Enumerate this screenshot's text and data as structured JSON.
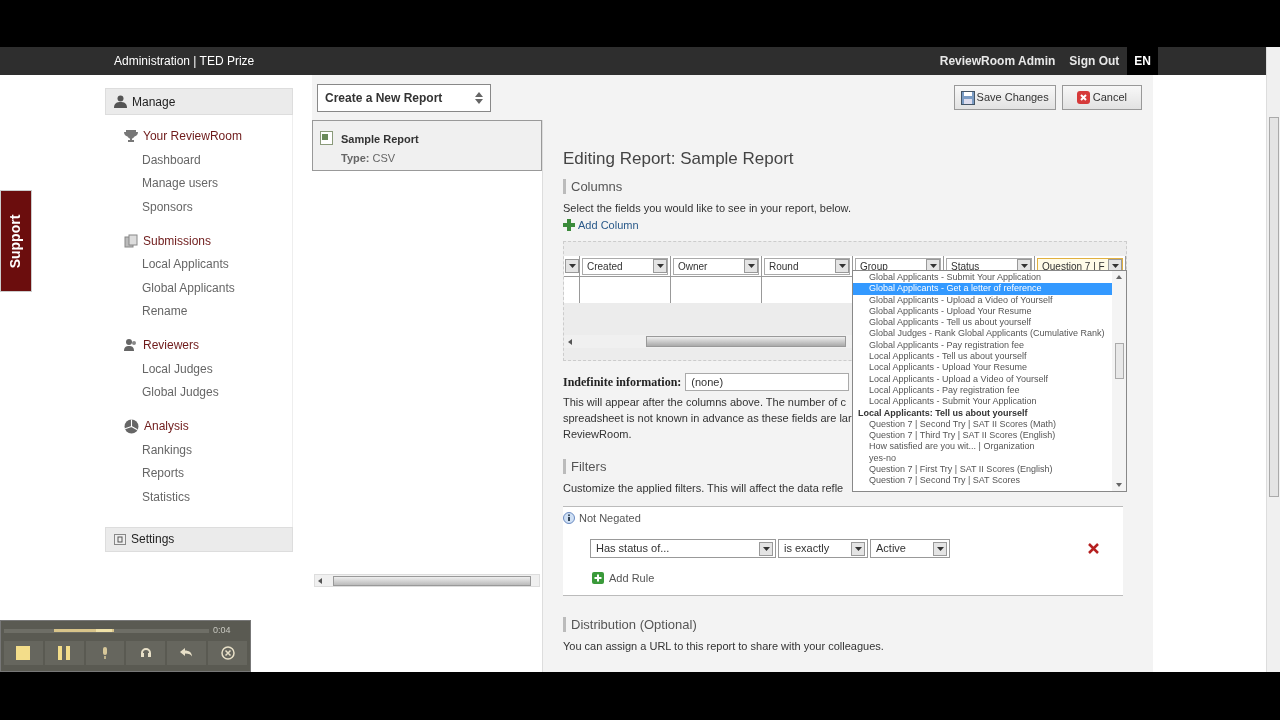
{
  "header": {
    "title": "Administration | TED Prize",
    "user": "ReviewRoom Admin",
    "sign_out": "Sign Out",
    "language": "EN"
  },
  "support_tab": "Support",
  "sidebar": {
    "manage": "Manage",
    "groups": [
      {
        "label": "Your ReviewRoom",
        "items": [
          "Dashboard",
          "Manage users",
          "Sponsors"
        ]
      },
      {
        "label": "Submissions",
        "items": [
          "Local Applicants",
          "Global Applicants",
          "Rename"
        ]
      },
      {
        "label": "Reviewers",
        "items": [
          "Local Judges",
          "Global Judges"
        ]
      },
      {
        "label": "Analysis",
        "items": [
          "Rankings",
          "Reports",
          "Statistics"
        ]
      }
    ],
    "settings": "Settings"
  },
  "toolbar": {
    "new_report_select": "Create a New Report",
    "save": "Save Changes",
    "cancel": "Cancel"
  },
  "reports": [
    {
      "name": "Sample Report",
      "type_label": "Type:",
      "type": "CSV",
      "selected": true
    }
  ],
  "editor": {
    "title": "Editing Report: Sample Report",
    "columns_section": {
      "heading": "Columns",
      "description": "Select the fields you would like to see in your report, below.",
      "add_column": "Add Column",
      "grid_columns": [
        {
          "label": "Created",
          "selected": false
        },
        {
          "label": "Owner",
          "selected": false
        },
        {
          "label": "Round",
          "selected": false
        },
        {
          "label": "Group",
          "selected": false
        },
        {
          "label": "Status",
          "selected": false
        },
        {
          "label": "Question 7 | F",
          "selected": true
        }
      ]
    },
    "indefinite": {
      "label": "Indefinite information:",
      "value": "(none)",
      "lines": [
        "This will appear after the columns above. The number of c",
        "spreadsheet is not known in advance as these fields are lar",
        "ReviewRoom."
      ]
    },
    "filters": {
      "heading": "Filters",
      "description": "Customize the applied filters. This will affect the data refle",
      "negation": "Not Negated",
      "rule": {
        "field": "Has status of...",
        "operator": "is exactly",
        "value": "Active"
      },
      "add_rule": "Add Rule"
    },
    "distribution": {
      "heading": "Distribution (Optional)",
      "description": "You can assign a URL to this report to share with your colleagues."
    }
  },
  "dropdown": [
    {
      "kind": "option",
      "label": "Global Applicants - Submit Your Application",
      "selected": false
    },
    {
      "kind": "option",
      "label": "Global Applicants - Get a letter of reference",
      "selected": true
    },
    {
      "kind": "option",
      "label": "Global Applicants - Upload a Video of Yourself",
      "selected": false
    },
    {
      "kind": "option",
      "label": "Global Applicants - Upload Your Resume",
      "selected": false
    },
    {
      "kind": "option",
      "label": "Global Applicants - Tell us about yourself",
      "selected": false
    },
    {
      "kind": "option",
      "label": "Global Judges - Rank Global Applicants (Cumulative Rank)",
      "selected": false
    },
    {
      "kind": "option",
      "label": "Global Applicants - Pay registration fee",
      "selected": false
    },
    {
      "kind": "option",
      "label": "Local Applicants - Tell us about yourself",
      "selected": false
    },
    {
      "kind": "option",
      "label": "Local Applicants - Upload Your Resume",
      "selected": false
    },
    {
      "kind": "option",
      "label": "Local Applicants - Upload a Video of Yourself",
      "selected": false
    },
    {
      "kind": "option",
      "label": "Local Applicants - Pay registration fee",
      "selected": false
    },
    {
      "kind": "option",
      "label": "Local Applicants - Submit Your Application",
      "selected": false
    },
    {
      "kind": "group",
      "label": "Local Applicants: Tell us about yourself",
      "selected": false
    },
    {
      "kind": "option",
      "label": "Question 7 | Second Try | SAT II Scores (Math)",
      "selected": false
    },
    {
      "kind": "option",
      "label": "Question 7 | Third Try | SAT II Scores (English)",
      "selected": false
    },
    {
      "kind": "option",
      "label": "How satisfied are you wit... | Organization",
      "selected": false
    },
    {
      "kind": "option",
      "label": "yes-no",
      "selected": false
    },
    {
      "kind": "option",
      "label": "Question 7 | First Try | SAT II Scores (English)",
      "selected": false
    },
    {
      "kind": "option",
      "label": "Question 7 | Second Try | SAT Scores",
      "selected": false
    }
  ],
  "recorder": {
    "time": "0:04"
  }
}
